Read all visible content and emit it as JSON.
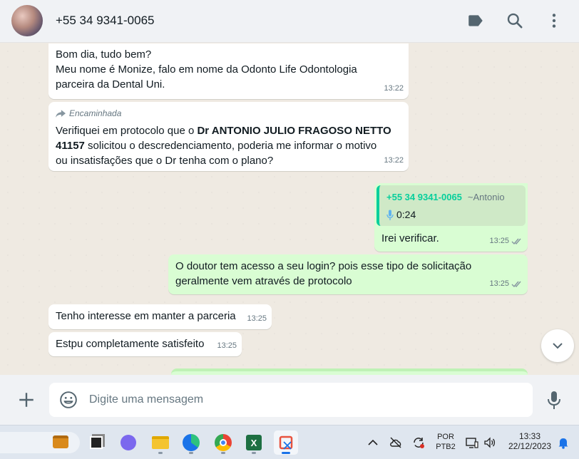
{
  "header": {
    "contact_name": "+55 34 9341-0065"
  },
  "messages": [
    {
      "lines": [
        "Bom dia, tudo bem?",
        "Meu nome é Monize, falo em nome da Odonto Life Odontologia",
        "parceira da Dental Uni."
      ],
      "time": "13:22"
    },
    {
      "forwarded_label": "Encaminhada",
      "text_pre": "Verifiquei em protocolo que o ",
      "text_bold1": "Dr ANTONIO JULIO FRAGOSO NETTO",
      "text_bold2": "41157",
      "text_line2_rest": " solicitou o descredenciamento, poderia me informar o motivo",
      "text_line3": "ou insatisfações que o Dr tenha com o plano?",
      "time": "13:22"
    },
    {
      "quote_name": "+55 34 9341-0065",
      "quote_alias": "~Antonio",
      "quote_audio": "0:24",
      "text": "Irei verificar.",
      "time": "13:25"
    },
    {
      "lines": [
        "O doutor tem acesso a seu login? pois esse tipo de solicitação",
        "geralmente vem através de protocolo"
      ],
      "time": "13:25"
    },
    {
      "text": "Tenho interesse em manter a parceria",
      "time": "13:25"
    },
    {
      "text": "Estpu completamente satisfeito",
      "time": "13:25"
    }
  ],
  "composer": {
    "placeholder": "Digite uma mensagem"
  },
  "taskbar": {
    "lang_top": "POR",
    "lang_bottom": "PTB2",
    "clock_time": "13:33",
    "clock_date": "22/12/2023"
  },
  "colors": {
    "outgoing_bubble": "#d9fdd3",
    "incoming_bubble": "#ffffff",
    "accent": "#06cf9c",
    "read_ticks": "#8696a0"
  },
  "icons": [
    "label-icon",
    "search-icon",
    "menu-icon",
    "forward-icon",
    "mic-small-icon",
    "double-check-icon",
    "chevron-down-icon",
    "plus-icon",
    "emoji-icon",
    "mic-icon"
  ]
}
